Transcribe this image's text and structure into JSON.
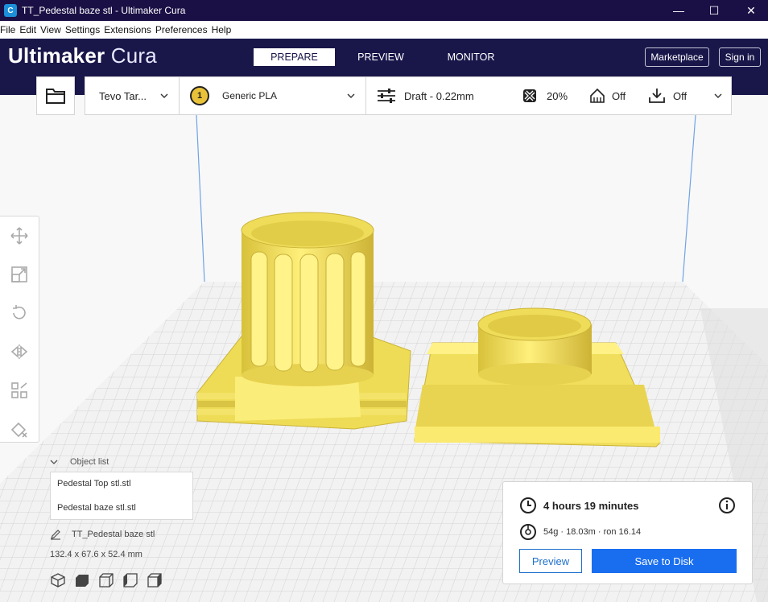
{
  "window": {
    "title": "TT_Pedestal baze stl - Ultimaker Cura",
    "app_icon": "C"
  },
  "menu": [
    "File",
    "Edit",
    "View",
    "Settings",
    "Extensions",
    "Preferences",
    "Help"
  ],
  "header": {
    "logo_bold": "Ultimaker",
    "logo_light": "Cura",
    "tabs": [
      "PREPARE",
      "PREVIEW",
      "MONITOR"
    ],
    "active_tab": "PREPARE",
    "marketplace_label": "Marketplace",
    "signin_label": "Sign in"
  },
  "settings_bar": {
    "printer": "Tevo Tar...",
    "extruder_number": "1",
    "material": "Generic PLA",
    "profile": "Draft - 0.22mm",
    "infill": "20%",
    "support": "Off",
    "adhesion": "Off"
  },
  "object_list": {
    "header": "Object list",
    "items": [
      "Pedestal Top stl.stl",
      "Pedestal baze stl.stl"
    ],
    "current_file": "TT_Pedestal baze stl",
    "dimensions": "132.4 x 67.6 x 52.4 mm"
  },
  "print_info": {
    "time": "4 hours 19 minutes",
    "material_usage": "54g · 18.03m · ron 16.14",
    "preview_label": "Preview",
    "save_label": "Save to Disk"
  },
  "colors": {
    "header_bg": "#19164a",
    "accent_blue": "#196ef0",
    "model_yellow": "#f5e05a"
  }
}
